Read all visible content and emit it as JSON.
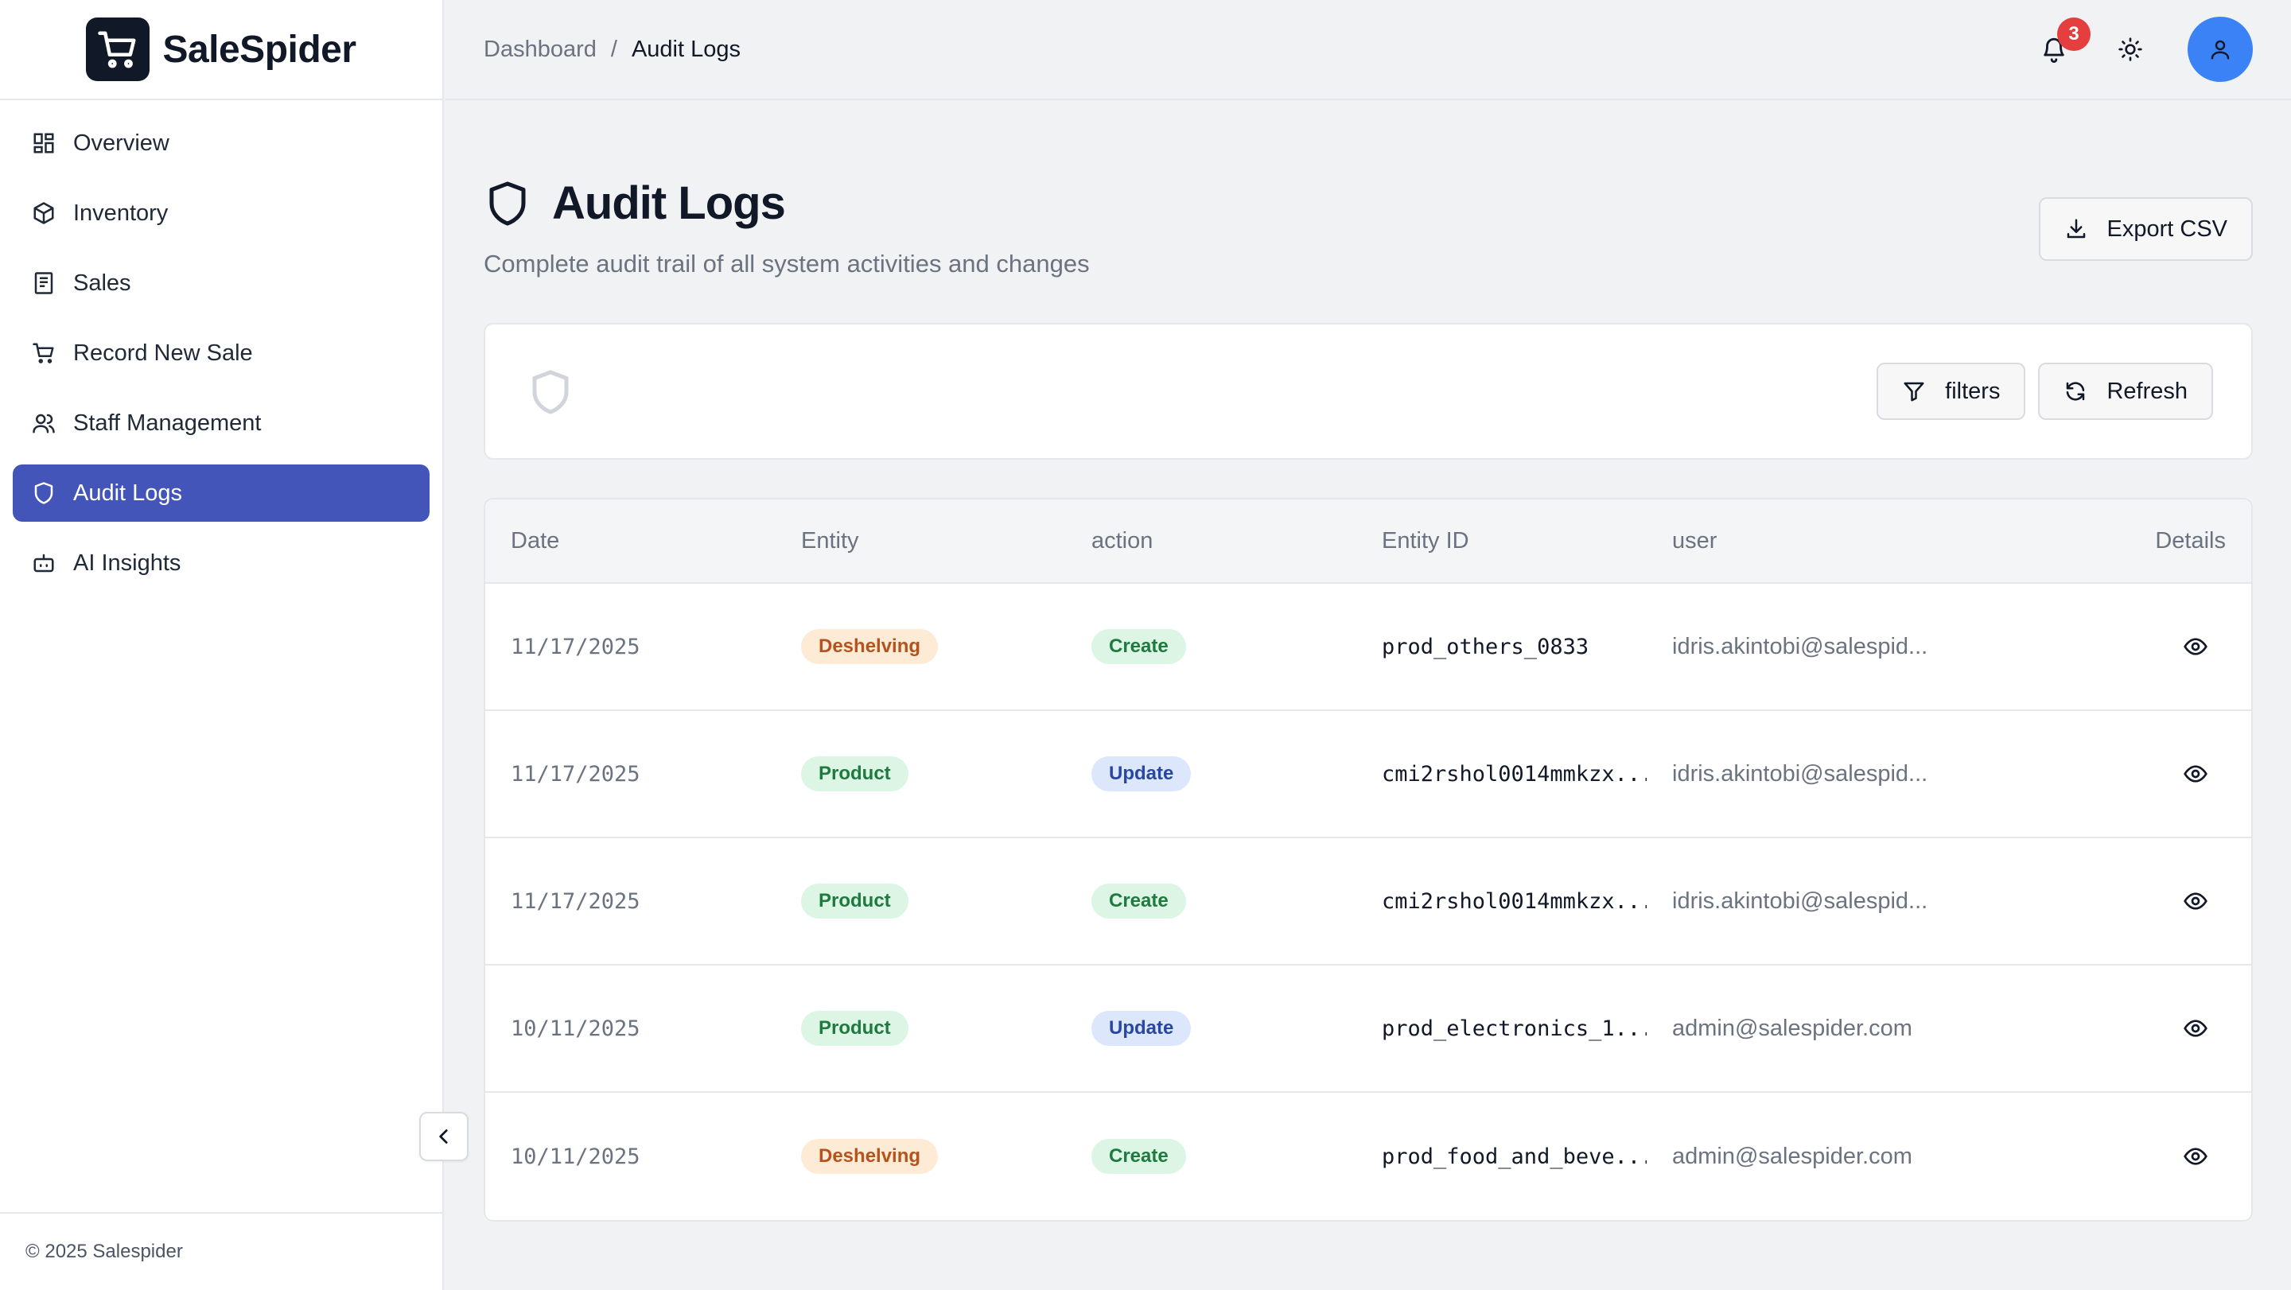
{
  "brand": {
    "name": "SaleSpider"
  },
  "sidebar": {
    "items": [
      {
        "label": "Overview",
        "icon": "grid-icon"
      },
      {
        "label": "Inventory",
        "icon": "box-icon"
      },
      {
        "label": "Sales",
        "icon": "receipt-icon"
      },
      {
        "label": "Record New Sale",
        "icon": "cart-icon"
      },
      {
        "label": "Staff Management",
        "icon": "users-icon"
      },
      {
        "label": "Audit Logs",
        "icon": "shield-icon",
        "active": true
      },
      {
        "label": "AI Insights",
        "icon": "bot-icon"
      }
    ],
    "footer": "© 2025 Salespider"
  },
  "topbar": {
    "breadcrumb": {
      "parent": "Dashboard",
      "separator": "/",
      "current": "Audit Logs"
    },
    "notification_count": "3"
  },
  "page": {
    "title": "Audit Logs",
    "subtitle": "Complete audit trail of all system activities and changes",
    "export_label": "Export CSV",
    "filters_label": "filters",
    "refresh_label": "Refresh"
  },
  "table": {
    "headers": {
      "date": "Date",
      "entity": "Entity",
      "action": "action",
      "entity_id": "Entity ID",
      "user": "user",
      "details": "Details"
    },
    "rows": [
      {
        "date": "11/17/2025",
        "entity": "Deshelving",
        "action": "Create",
        "entity_id": "prod_others_0833",
        "user": "idris.akintobi@salespid..."
      },
      {
        "date": "11/17/2025",
        "entity": "Product",
        "action": "Update",
        "entity_id": "cmi2rshol0014mmkzx...",
        "user": "idris.akintobi@salespid..."
      },
      {
        "date": "11/17/2025",
        "entity": "Product",
        "action": "Create",
        "entity_id": "cmi2rshol0014mmkzx...",
        "user": "idris.akintobi@salespid..."
      },
      {
        "date": "10/11/2025",
        "entity": "Product",
        "action": "Update",
        "entity_id": "prod_electronics_1...",
        "user": "admin@salespider.com"
      },
      {
        "date": "10/11/2025",
        "entity": "Deshelving",
        "action": "Create",
        "entity_id": "prod_food_and_beve...",
        "user": "admin@salespider.com"
      }
    ]
  },
  "colors": {
    "accent": "#4355b9",
    "avatar": "#3b82f6",
    "badge": "#e53e3e"
  }
}
